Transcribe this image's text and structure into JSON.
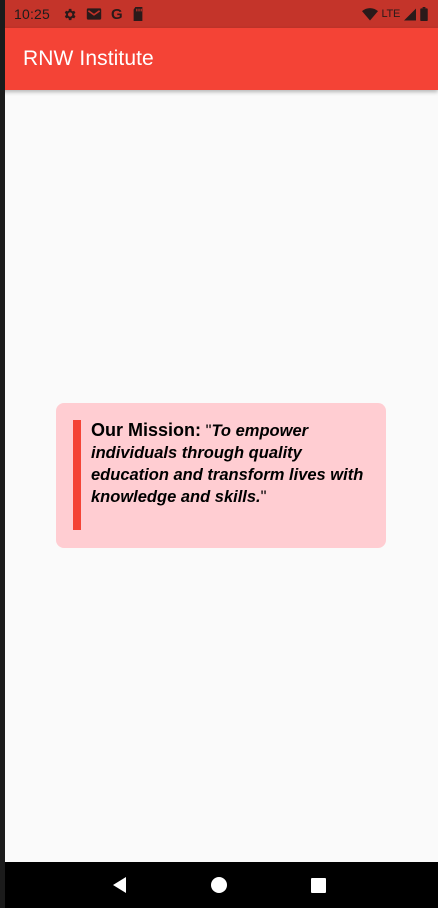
{
  "status_bar": {
    "time": "10:25",
    "left_icons": [
      "gear-icon",
      "gmail-icon",
      "google-g-icon",
      "sd-card-icon"
    ],
    "google_letter": "G",
    "network_label": "LTE",
    "right_icons": [
      "wifi-icon",
      "signal-icon",
      "battery-icon"
    ]
  },
  "app_bar": {
    "title": "RNW Institute",
    "color": "#f44336"
  },
  "mission_card": {
    "label": "Our Mission:",
    "quote_open": " \"",
    "quote_text": "To empower individuals through quality education and transform lives with knowledge and skills.",
    "quote_close": "\"",
    "background": "#ffcdd2",
    "accent": "#f44336"
  },
  "nav_bar": {
    "buttons": [
      "back-icon",
      "home-icon",
      "recents-icon"
    ]
  }
}
